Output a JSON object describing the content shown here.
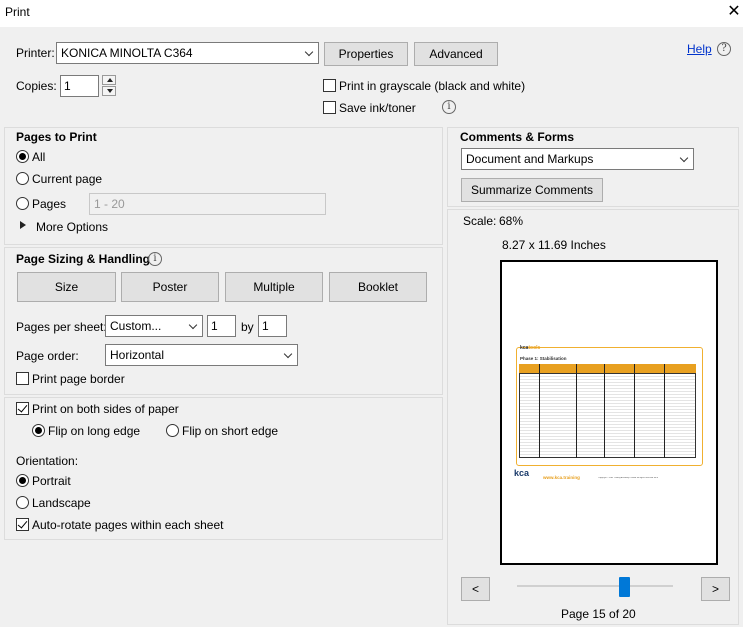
{
  "window": {
    "title": "Print"
  },
  "printer": {
    "label": "Printer:",
    "selected": "KONICA MINOLTA C364",
    "properties_label": "Properties",
    "advanced_label": "Advanced",
    "help_label": "Help"
  },
  "copies": {
    "label": "Copies:",
    "value": "1"
  },
  "options": {
    "grayscale_label": "Print in grayscale (black and white)",
    "grayscale_checked": false,
    "save_ink_label": "Save ink/toner",
    "save_ink_checked": false
  },
  "pages_to_print": {
    "title": "Pages to Print",
    "all_label": "All",
    "current_label": "Current page",
    "pages_label": "Pages",
    "pages_placeholder": "1 - 20",
    "more_options_label": "More Options",
    "selected": "All"
  },
  "sizing": {
    "title": "Page Sizing & Handling",
    "buttons": [
      "Size",
      "Poster",
      "Multiple",
      "Booklet"
    ],
    "pages_per_sheet_label": "Pages per sheet:",
    "pages_per_sheet_value": "Custom...",
    "rows": "1",
    "by_label": "by",
    "cols": "1",
    "page_order_label": "Page order:",
    "page_order_value": "Horizontal",
    "print_border_label": "Print page border",
    "print_border_checked": false
  },
  "duplex": {
    "both_sides_label": "Print on both sides of paper",
    "both_sides_checked": true,
    "long_edge_label": "Flip on long edge",
    "short_edge_label": "Flip on short edge",
    "selected": "long"
  },
  "orientation": {
    "label": "Orientation:",
    "portrait_label": "Portrait",
    "landscape_label": "Landscape",
    "auto_rotate_label": "Auto-rotate pages within each sheet",
    "selected": "Portrait",
    "auto_rotate_checked": true
  },
  "comments_forms": {
    "title": "Comments & Forms",
    "selected": "Document and Markups",
    "summarize_label": "Summarize Comments"
  },
  "preview": {
    "scale_label": "Scale:",
    "scale_value": "68%",
    "paper_size": "8.27 x 11.69 Inches",
    "prev_label": "<",
    "next_label": ">",
    "page_indicator": "Page 15 of 20",
    "slider_fraction": 0.7,
    "doc_brand": "kca",
    "doc_brand_tools": "tools",
    "doc_heading": "Phase 1: Stabilisation",
    "doc_footer_logo": "kca",
    "doc_footer_url": "www.kca.training",
    "doc_footer_copy": "Copyright © Kids' Coding Academy Limited. All rights reserved. All resources are for educational use."
  },
  "colors": {
    "accent": "#e8a020",
    "link": "#0033cc",
    "background": "#f0f0f0"
  }
}
